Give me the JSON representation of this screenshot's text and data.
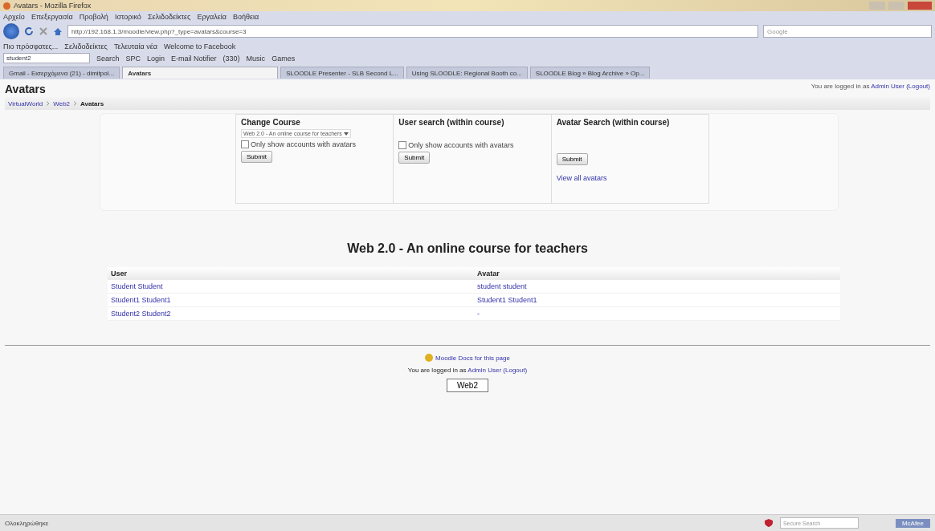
{
  "window": {
    "title": "Avatars - Mozilla Firefox"
  },
  "menu": [
    "Αρχείο",
    "Επεξεργασία",
    "Προβολή",
    "Ιστορικό",
    "Σελιδοδείκτες",
    "Εργαλεία",
    "Βοήθεια"
  ],
  "address": {
    "url": "http://192.168.1.3/moodle/view.php?_type=avatars&course=3",
    "search_placeholder": "Google"
  },
  "bookmarks": [
    "Πιο πρόσφατες...",
    "Σελιδοδείκτες",
    "Τελευταία νέα",
    "Welcome to Facebook"
  ],
  "toolbar": {
    "search_value": "student2",
    "items": [
      "Search",
      "SPC",
      "Login",
      "E-mail Notifier",
      "(330)",
      "Music",
      "Games"
    ]
  },
  "tabs": [
    {
      "label": "Gmail - Εισερχόμενα (21) - dimitpol...",
      "selected": false
    },
    {
      "label": "Avatars",
      "selected": true
    },
    {
      "label": "SLOODLE Presenter - SLB Second L...",
      "selected": false
    },
    {
      "label": "Using SLOODLE: Regional Booth co...",
      "selected": false
    },
    {
      "label": "SLOODLE Blog » Blog Archive » Op...",
      "selected": false
    }
  ],
  "page": {
    "heading": "Avatars",
    "login_prefix": "You are logged in as",
    "login_user": "Admin User",
    "logout": "(Logout)",
    "breadcrumb": [
      {
        "label": "VirtualWorld",
        "link": true
      },
      {
        "label": "Web2",
        "link": true
      },
      {
        "label": "Avatars",
        "link": false
      }
    ],
    "panels": [
      {
        "title": "Change Course",
        "select": "Web 2.0 - An online course for teachers",
        "checkbox": {
          "label": "Only show accounts with avatars",
          "checked": false
        },
        "button": "Submit"
      },
      {
        "title": "User search (within course)",
        "checkbox": {
          "label": "Only show accounts with avatars",
          "checked": false
        },
        "button": "Submit"
      },
      {
        "title": "Avatar Search (within course)",
        "button": "Submit",
        "link": "View all avatars"
      }
    ],
    "course_title": "Web 2.0 - An online course for teachers",
    "table": {
      "columns": [
        "User",
        "Avatar"
      ],
      "rows": [
        [
          "Student Student",
          "student student"
        ],
        [
          "Student1 Student1",
          "Student1 Student1"
        ],
        [
          "Student2 Student2",
          "-"
        ]
      ]
    },
    "footer": {
      "docs": "Moodle Docs for this page",
      "login_prefix": "You are logged in as",
      "login_user": "Admin User",
      "logout": "(Logout)",
      "button": "Web2"
    }
  },
  "status_bar": {
    "text": "Ολοκληρώθηκε",
    "search_placeholder": "Secure Search",
    "badge": "McAfee"
  }
}
